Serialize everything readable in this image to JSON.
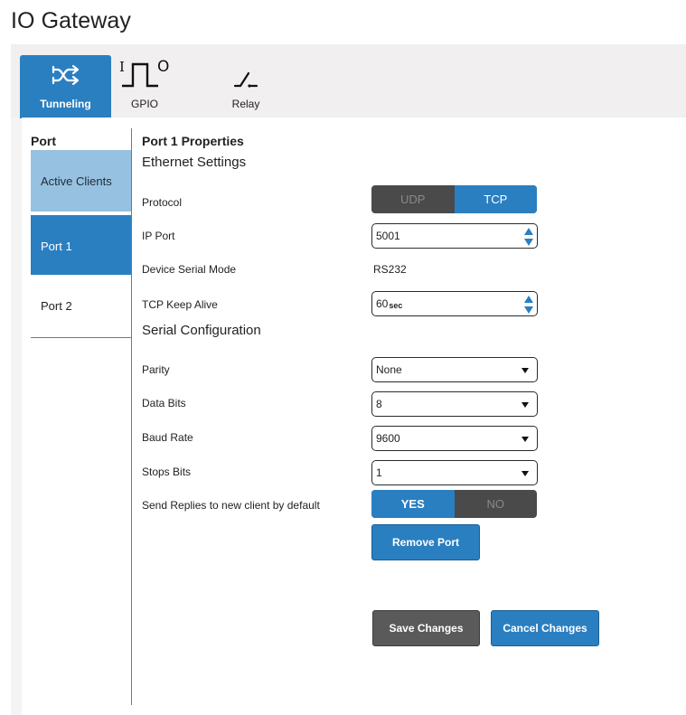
{
  "page": {
    "title": "IO Gateway"
  },
  "tabs": [
    {
      "label": "Tunneling",
      "icon": "shuffle-icon",
      "active": true
    },
    {
      "label": "GPIO",
      "icon": "gpio-signal-icon",
      "active": false
    },
    {
      "label": "Relay",
      "icon": "relay-switch-icon",
      "active": false
    }
  ],
  "gpio_icon": {
    "in_letter": "I",
    "out_letter": "O"
  },
  "sidebar": {
    "title": "Port",
    "items": [
      {
        "label": "Active Clients"
      },
      {
        "label": "Port 1"
      },
      {
        "label": "Port 2"
      }
    ]
  },
  "properties": {
    "title": "Port 1 Properties",
    "ethernet_heading": "Ethernet Settings",
    "serial_heading": "Serial Configuration",
    "protocol": {
      "label": "Protocol",
      "options": [
        "UDP",
        "TCP"
      ],
      "selected": "TCP"
    },
    "ip_port": {
      "label": "IP Port",
      "value": "5001"
    },
    "serial_mode": {
      "label": "Device Serial Mode",
      "value": "RS232"
    },
    "keep_alive": {
      "label": "TCP Keep Alive",
      "value": "60",
      "unit": "sec"
    },
    "parity": {
      "label": "Parity",
      "value": "None"
    },
    "data_bits": {
      "label": "Data Bits",
      "value": "8"
    },
    "baud_rate": {
      "label": "Baud Rate",
      "value": "9600"
    },
    "stop_bits": {
      "label": "Stops Bits",
      "value": "1"
    },
    "send_replies": {
      "label": "Send Replies to new client by default",
      "options": [
        "YES",
        "NO"
      ],
      "selected": "YES"
    },
    "remove_port_label": "Remove Port"
  },
  "actions": {
    "save_label": "Save Changes",
    "cancel_label": "Cancel Changes"
  },
  "colors": {
    "accent": "#2a7fc1",
    "accent_light": "#97c1e1",
    "dark_button": "#5a5a5a",
    "toggle_bg": "#4a4a4a"
  }
}
